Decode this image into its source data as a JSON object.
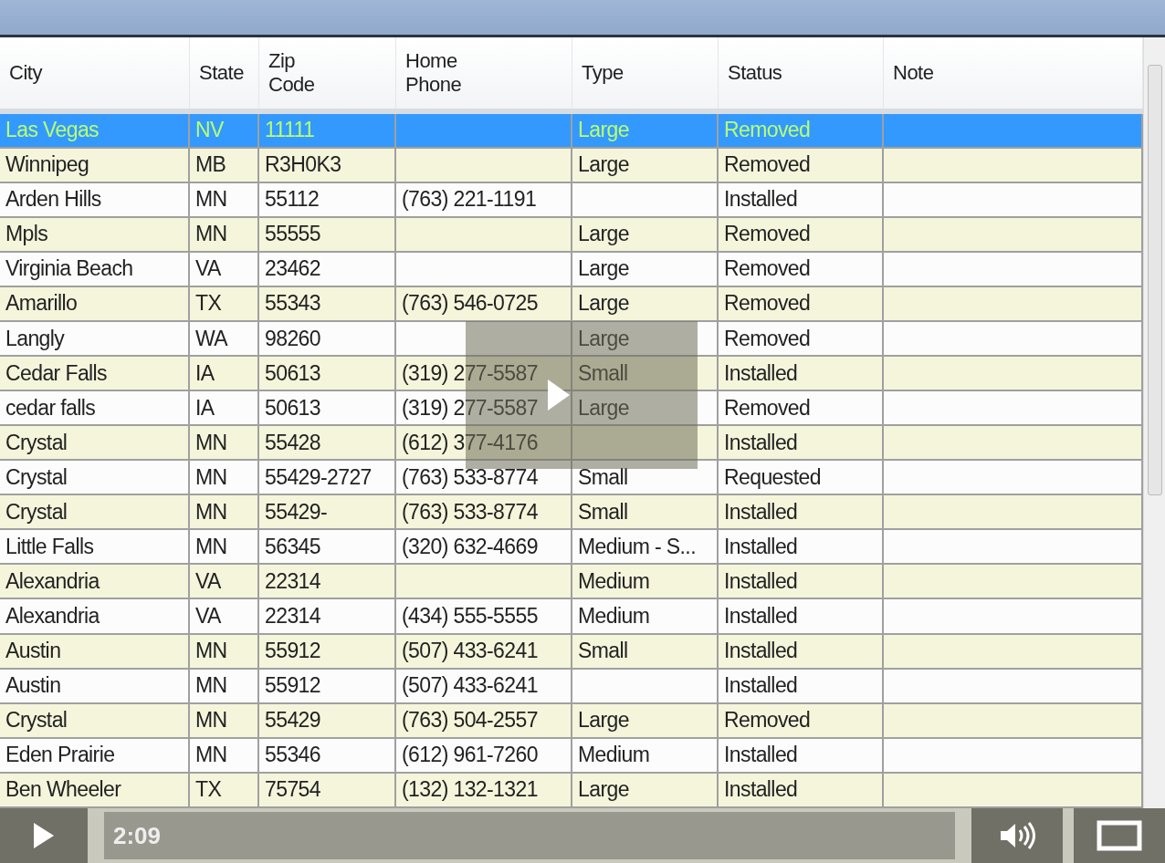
{
  "table": {
    "columns": [
      "City",
      "State",
      "Zip\nCode",
      "Home\nPhone",
      "Type",
      "Status",
      "Note"
    ],
    "rows": [
      {
        "cells": [
          "Las Vegas",
          "NV",
          "11111",
          "",
          "Large",
          "Removed",
          ""
        ],
        "selected": true
      },
      {
        "cells": [
          "Winnipeg",
          "MB",
          "R3H0K3",
          "",
          "Large",
          "Removed",
          ""
        ],
        "selected": false
      },
      {
        "cells": [
          "Arden Hills",
          "MN",
          "55112",
          "(763) 221-1191",
          "",
          "Installed",
          ""
        ],
        "selected": false
      },
      {
        "cells": [
          "Mpls",
          "MN",
          "55555",
          "",
          "Large",
          "Removed",
          ""
        ],
        "selected": false
      },
      {
        "cells": [
          "Virginia Beach",
          "VA",
          "23462",
          "",
          "Large",
          "Removed",
          ""
        ],
        "selected": false
      },
      {
        "cells": [
          "Amarillo",
          "TX",
          "55343",
          "(763) 546-0725",
          "Large",
          "Removed",
          ""
        ],
        "selected": false
      },
      {
        "cells": [
          "Langly",
          "WA",
          "98260",
          "",
          "Large",
          "Removed",
          ""
        ],
        "selected": false
      },
      {
        "cells": [
          "Cedar Falls",
          "IA",
          "50613",
          "(319) 277-5587",
          "Small",
          "Installed",
          ""
        ],
        "selected": false
      },
      {
        "cells": [
          "cedar falls",
          "IA",
          "50613",
          "(319) 277-5587",
          "Large",
          "Removed",
          ""
        ],
        "selected": false
      },
      {
        "cells": [
          "Crystal",
          "MN",
          "55428",
          "(612) 377-4176",
          "",
          "Installed",
          ""
        ],
        "selected": false
      },
      {
        "cells": [
          "Crystal",
          "MN",
          "55429-2727",
          "(763) 533-8774",
          "Small",
          "Requested",
          ""
        ],
        "selected": false
      },
      {
        "cells": [
          "Crystal",
          "MN",
          "55429-",
          "(763) 533-8774",
          "Small",
          "Installed",
          ""
        ],
        "selected": false
      },
      {
        "cells": [
          "Little Falls",
          "MN",
          "56345",
          "(320) 632-4669",
          "Medium - S...",
          "Installed",
          ""
        ],
        "selected": false
      },
      {
        "cells": [
          "Alexandria",
          "VA",
          "22314",
          "",
          "Medium",
          "Installed",
          ""
        ],
        "selected": false
      },
      {
        "cells": [
          "Alexandria",
          "VA",
          "22314",
          "(434) 555-5555",
          "Medium",
          "Installed",
          ""
        ],
        "selected": false
      },
      {
        "cells": [
          "Austin",
          "MN",
          "55912",
          "(507) 433-6241",
          "Small",
          "Installed",
          ""
        ],
        "selected": false
      },
      {
        "cells": [
          "Austin",
          "MN",
          "55912",
          "(507) 433-6241",
          "",
          "Installed",
          ""
        ],
        "selected": false
      },
      {
        "cells": [
          "Crystal",
          "MN",
          "55429",
          "(763) 504-2557",
          "Large",
          "Removed",
          ""
        ],
        "selected": false
      },
      {
        "cells": [
          "Eden Prairie",
          "MN",
          "55346",
          "(612) 961-7260",
          "Medium",
          "Installed",
          ""
        ],
        "selected": false
      },
      {
        "cells": [
          "Ben Wheeler",
          "TX",
          "75754",
          "(132) 132-1321",
          "Large",
          "Installed",
          ""
        ],
        "selected": false
      }
    ]
  },
  "player": {
    "time": "2:09"
  }
}
